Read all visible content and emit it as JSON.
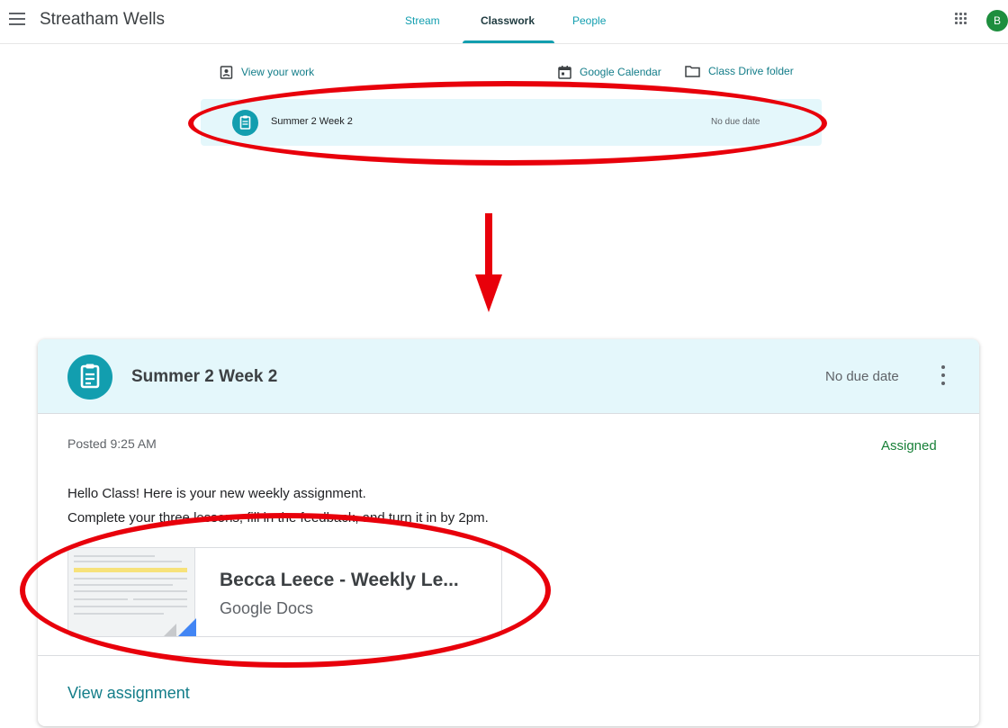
{
  "topbar": {
    "class_name": "Streatham Wells",
    "tabs": [
      {
        "label": "Stream"
      },
      {
        "label": "Classwork"
      },
      {
        "label": "People"
      }
    ],
    "active_tab": "Classwork",
    "avatar_initial": "B"
  },
  "links": {
    "view_work": "View your work",
    "calendar": "Google Calendar",
    "drive": "Class Drive folder"
  },
  "topic_row": {
    "title": "Summer 2 Week 2",
    "due": "No due date"
  },
  "card": {
    "title": "Summer 2 Week 2",
    "due": "No due date",
    "posted": "Posted 9:25 AM",
    "status": "Assigned",
    "description_line1": "Hello Class! Here is your new weekly assignment.",
    "description_line2": "Complete your three lessons, fill in the feedback, and turn it in by 2pm.",
    "attachment": {
      "title": "Becca Leece - Weekly Le...",
      "type": "Google Docs"
    },
    "view_link": "View assignment"
  },
  "colors": {
    "accent": "#129eaf",
    "highlight_bg": "#e4f7fb",
    "annotation_red": "#e8000b",
    "assigned_green": "#188038"
  }
}
